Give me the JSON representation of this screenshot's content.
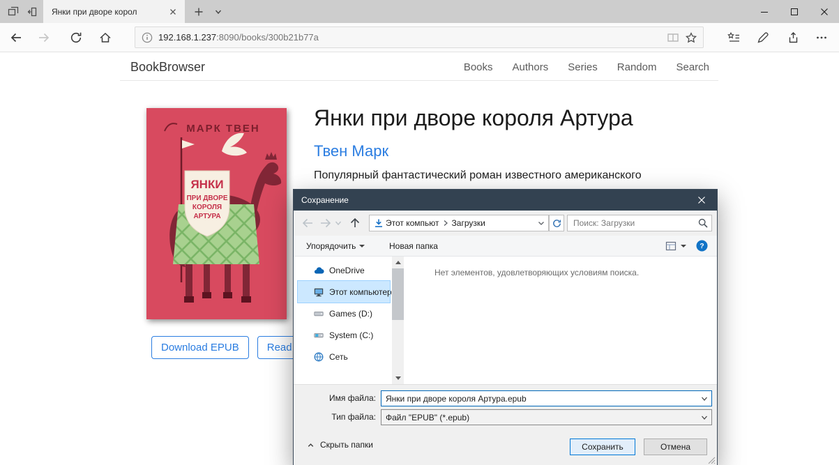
{
  "browser": {
    "tab": {
      "title": "Янки при дворе корол"
    },
    "url": {
      "host": "192.168.1.237",
      "path": ":8090/books/300b21b77a"
    }
  },
  "page": {
    "brand": "BookBrowser",
    "nav": [
      {
        "label": "Books"
      },
      {
        "label": "Authors"
      },
      {
        "label": "Series"
      },
      {
        "label": "Random"
      },
      {
        "label": "Search"
      }
    ],
    "book": {
      "title": "Янки при дворе короля Артура",
      "author": "Твен Марк",
      "description": "Популярный фантастический роман известного американского",
      "download_label": "Download EPUB",
      "read_label": "Read",
      "cover": {
        "author_text": "МАРК ТВЕН",
        "title_lines": [
          "ЯНКИ",
          "ПРИ ДВОРЕ",
          "КОРОЛЯ",
          "АРТУРА"
        ]
      }
    }
  },
  "dialog": {
    "title": "Сохранение",
    "nav": {
      "breadcrumb_root": "Этот компьют",
      "breadcrumb_folder": "Загрузки",
      "search_placeholder": "Поиск: Загрузки"
    },
    "toolbar": {
      "organize": "Упорядочить",
      "new_folder": "Новая папка"
    },
    "sidebar": {
      "items": [
        {
          "label": "OneDrive",
          "icon": "onedrive-cloud",
          "selected": false
        },
        {
          "label": "Этот компьютер",
          "icon": "this-pc",
          "selected": true
        },
        {
          "label": "Games (D:)",
          "icon": "drive",
          "selected": false
        },
        {
          "label": "System (C:)",
          "icon": "system-drive",
          "selected": false
        },
        {
          "label": "Сеть",
          "icon": "network",
          "selected": false
        }
      ]
    },
    "list": {
      "empty_message": "Нет элементов, удовлетворяющих условиям поиска."
    },
    "fields": {
      "name_label": "Имя файла:",
      "name_value": "Янки при дворе короля Артура.epub",
      "type_label": "Тип файла:",
      "type_value": "Файл \"EPUB\" (*.epub)"
    },
    "footer": {
      "hide_folders": "Скрыть папки",
      "save": "Сохранить",
      "cancel": "Отмена"
    }
  },
  "colors": {
    "titlebar": "#334251",
    "accent": "#0078d7",
    "link": "#2b7de1",
    "selection": "#cce8ff",
    "cover_bg": "#d84a5f"
  }
}
